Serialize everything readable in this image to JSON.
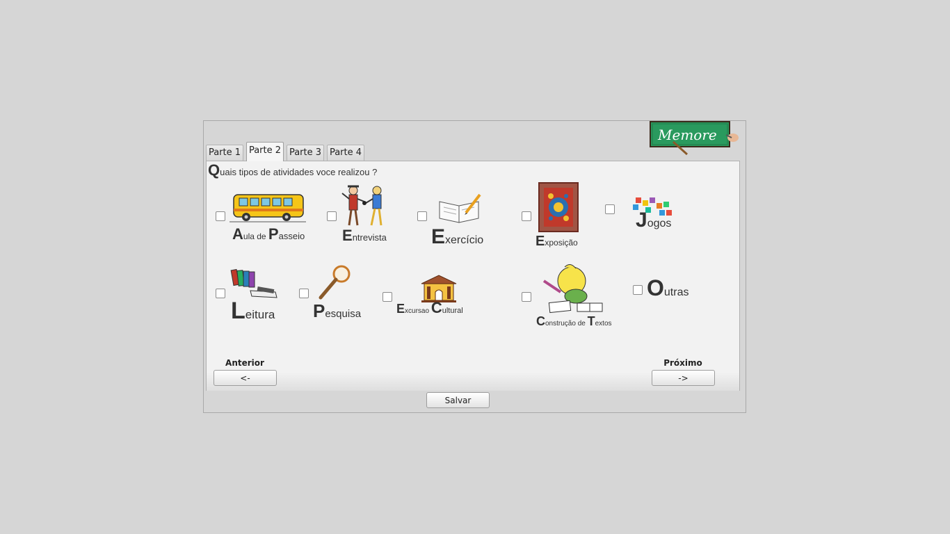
{
  "tabs": [
    {
      "label": "Parte 1",
      "active": false
    },
    {
      "label": "Parte 2",
      "active": true
    },
    {
      "label": "Parte 3",
      "active": false
    },
    {
      "label": "Parte 4",
      "active": false
    }
  ],
  "logo": {
    "text": "Memore"
  },
  "question": {
    "initial": "Q",
    "rest": "uais tipos de atividades voce realizou ?"
  },
  "options": {
    "aula_passeio": {
      "c1": "A",
      "t1": "ula de ",
      "c2": "P",
      "t2": "asseio",
      "icon": "school-bus-icon",
      "checked": false
    },
    "entrevista": {
      "c1": "E",
      "t1": "ntrevista",
      "icon": "interview-icon",
      "checked": false
    },
    "exercicio": {
      "c1": "E",
      "t1": "xercício",
      "icon": "book-pencil-icon",
      "checked": false
    },
    "exposicao": {
      "c1": "E",
      "t1": "xposição",
      "icon": "framed-painting-icon",
      "checked": false
    },
    "jogos": {
      "c1": "J",
      "t1": "ogos",
      "icon": "puzzle-icon",
      "checked": false
    },
    "leitura": {
      "c1": "L",
      "t1": "eitura",
      "icon": "books-icon",
      "checked": false
    },
    "pesquisa": {
      "c1": "P",
      "t1": "esquisa",
      "icon": "magnifier-icon",
      "checked": false
    },
    "excursao": {
      "c1": "E",
      "t1": "xcursao ",
      "c2": "C",
      "t2": "ultural",
      "icon": "museum-icon",
      "checked": false
    },
    "construcao": {
      "c1": "C",
      "t1": "onstrução de ",
      "c2": "T",
      "t2": "extos",
      "icon": "child-writing-icon",
      "checked": false
    },
    "outras": {
      "c1": "O",
      "t1": "utras",
      "checked": false
    }
  },
  "nav": {
    "previous_label": "Anterior",
    "previous_button": "<-",
    "next_label": "Próximo",
    "next_button": "->",
    "save_button": "Salvar"
  }
}
